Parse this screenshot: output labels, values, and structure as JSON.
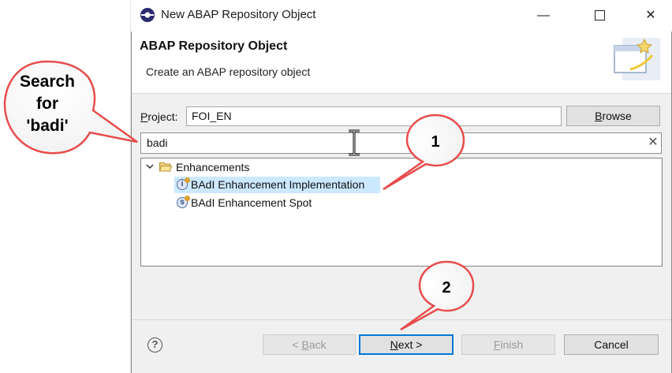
{
  "window": {
    "title": "New ABAP Repository Object",
    "controls": {
      "minimize": "—",
      "close": "✕"
    }
  },
  "header": {
    "title": "ABAP Repository Object",
    "subtitle": "Create an ABAP repository object",
    "icon": "new-object-wizard-icon"
  },
  "project": {
    "label_prefix": "P",
    "label_rest": "roject:",
    "value": "FOI_EN",
    "browse_prefix": "B",
    "browse_rest": "rowse"
  },
  "search": {
    "value": "badi",
    "clear_glyph": "✕"
  },
  "tree": {
    "group": {
      "label": "Enhancements",
      "expanded": true
    },
    "items": [
      {
        "label": "BAdI Enhancement Implementation",
        "selected": true,
        "icon": "badi-implementation-icon"
      },
      {
        "label": "BAdI Enhancement Spot",
        "selected": false,
        "icon": "badi-spot-icon"
      }
    ]
  },
  "footer": {
    "help_glyph": "?",
    "back": {
      "pre": "< ",
      "ul": "B",
      "post": "ack",
      "enabled": false
    },
    "next": {
      "ul": "N",
      "post": "ext >",
      "enabled": true
    },
    "finish": {
      "ul": "F",
      "post": "inish",
      "enabled": false
    },
    "cancel": {
      "label": "Cancel"
    }
  },
  "annotations": {
    "search_bubble": {
      "line1": "Search",
      "line2": "for",
      "line3": "'badi'"
    },
    "step1": "1",
    "step2": "2",
    "callout_color": "#e84c4c"
  }
}
